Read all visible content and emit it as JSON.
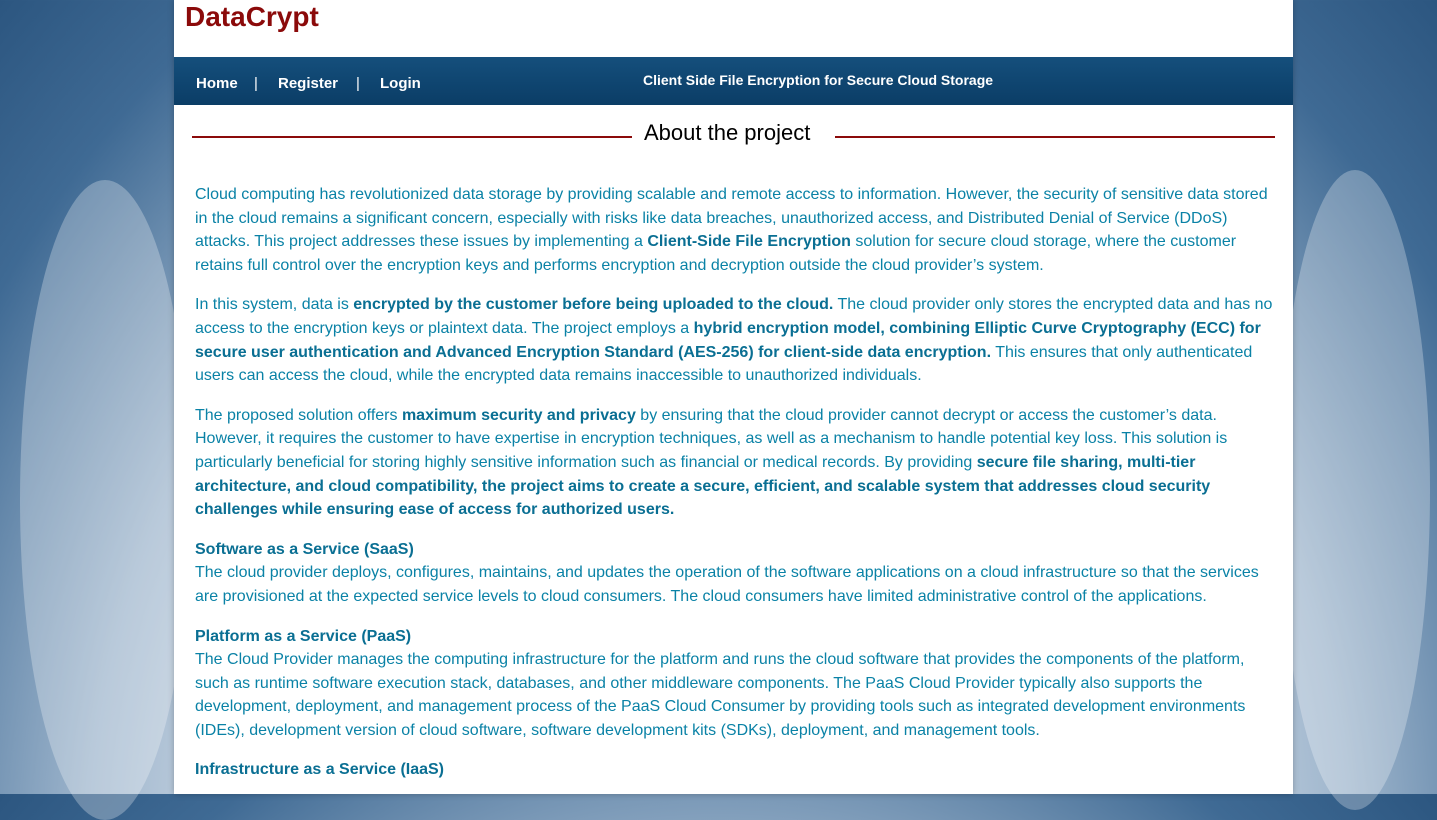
{
  "app": {
    "logo": "DataCrypt",
    "tagline": "Client Side File Encryption for Secure Cloud Storage"
  },
  "nav": {
    "items": [
      {
        "label": "Home"
      },
      {
        "label": "Register"
      },
      {
        "label": "Login"
      }
    ],
    "separator": "|"
  },
  "section": {
    "title": "About the project"
  },
  "paragraphs": {
    "p1": {
      "a": "Cloud computing has revolutionized data storage by providing scalable and remote access to information. However, the security of sensitive data stored in the cloud remains a significant concern, especially with risks like data breaches, unauthorized access, and Distributed Denial of Service (DDoS) attacks. This project addresses these issues by implementing a ",
      "b": "Client-Side File Encryption",
      "c": " solution for secure cloud storage, where the customer retains full control over the encryption keys and performs encryption and decryption outside the cloud provider’s system."
    },
    "p2": {
      "a": "In this system, data is ",
      "b": "encrypted by the customer before being uploaded to the cloud.",
      "c": " The cloud provider only stores the encrypted data and has no access to the encryption keys or plaintext data. The project employs a ",
      "d": "hybrid encryption model, combining Elliptic Curve Cryptography (ECC) for secure user authentication and Advanced Encryption Standard (AES-256) for client-side data encryption.",
      "e": " This ensures that only authenticated users can access the cloud, while the encrypted data remains inaccessible to unauthorized individuals."
    },
    "p3": {
      "a": "The proposed solution offers ",
      "b": "maximum security and privacy",
      "c": " by ensuring that the cloud provider cannot decrypt or access the customer’s data. However, it requires the customer to have expertise in encryption techniques, as well as a mechanism to handle potential key loss. This solution is particularly beneficial for storing highly sensitive information such as financial or medical records. By providing ",
      "d": "secure file sharing, multi-tier architecture, and cloud compatibility, the project aims to create a secure, efficient, and scalable system that addresses cloud security challenges while ensuring ease of access for authorized users."
    },
    "saas": {
      "heading": "Software as a Service (SaaS)",
      "text": "The cloud provider deploys, configures, maintains, and updates the operation of the software applications on a cloud infrastructure so that the services are provisioned at the expected service levels to cloud consumers. The cloud consumers have limited administrative control of the applications."
    },
    "paas": {
      "heading": "Platform as a Service (PaaS)",
      "text": "The Cloud Provider manages the computing infrastructure for the platform and runs the cloud software that provides the components of the platform, such as runtime software execution stack, databases, and other middleware components. The PaaS Cloud Provider typically also supports the development, deployment, and management process of the PaaS Cloud Consumer by providing tools such as integrated development environments (IDEs), development version of cloud software, software development kits (SDKs), deployment, and management tools."
    },
    "iaas": {
      "heading": "Infrastructure as a Service (IaaS)"
    }
  },
  "colors": {
    "logo": "#8b0a0a",
    "navbar": "#0f4570",
    "rule": "#8b0a0a",
    "body_text": "#0a82a6",
    "bold_text": "#0a6f93"
  }
}
